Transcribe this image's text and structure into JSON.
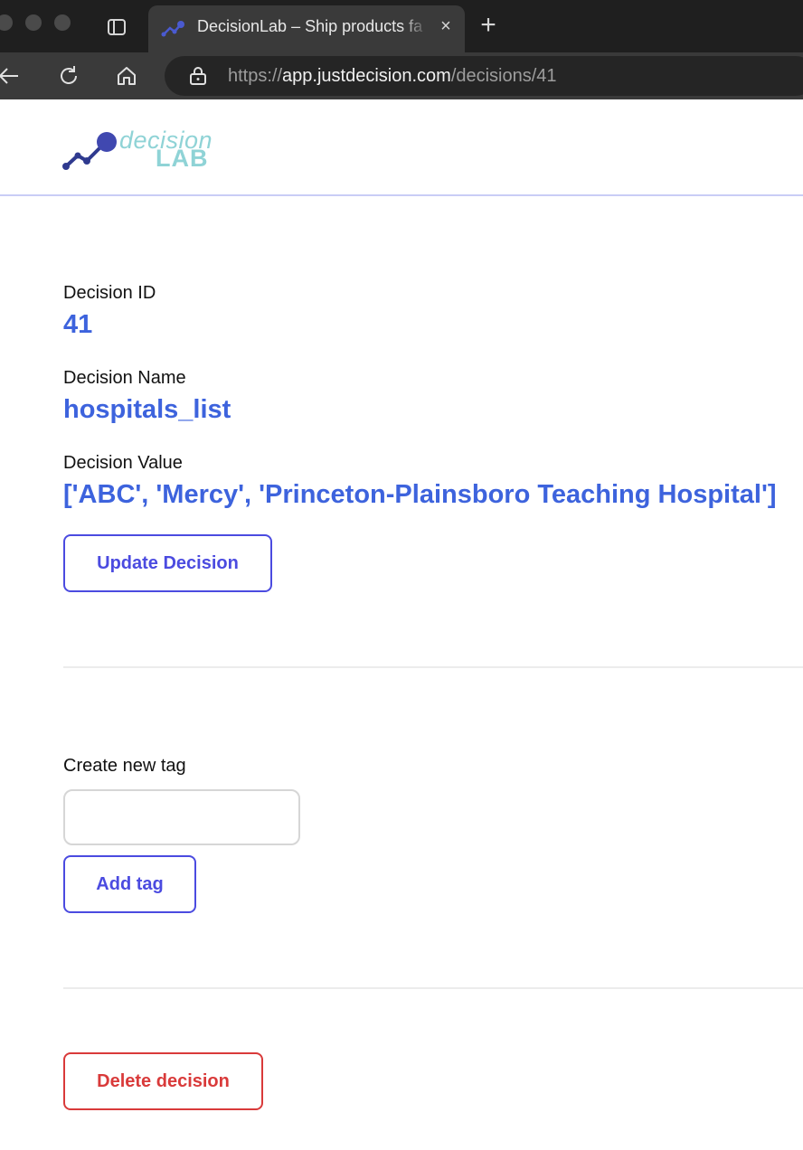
{
  "browser": {
    "tab_title": "DecisionLab – Ship products fa",
    "close_glyph": "×",
    "new_tab_glyph": "+",
    "url_scheme": "https://",
    "url_host": "app.justdecision.com",
    "url_path": "/decisions/41",
    "icons": [
      "tab-overview-icon",
      "back-icon",
      "reload-icon",
      "home-icon",
      "lock-icon",
      "favicon"
    ]
  },
  "logo": {
    "top_text": "decision",
    "bottom_text": "LAB"
  },
  "decision": {
    "id_label": "Decision ID",
    "id_value": "41",
    "name_label": "Decision Name",
    "name_value": "hospitals_list",
    "value_label": "Decision Value",
    "value_value": "['ABC', 'Mercy', 'Princeton-Plainsboro Teaching Hospital']",
    "update_button": "Update Decision"
  },
  "tags": {
    "create_label": "Create new tag",
    "input_value": "",
    "add_button": "Add tag"
  },
  "danger": {
    "delete_button": "Delete decision"
  },
  "colors": {
    "accent_blue": "#3d63dd",
    "button_indigo": "#4b4be0",
    "danger_red": "#d93a3a",
    "logo_teal": "#8fd3d6",
    "logo_navy": "#2f3a8f"
  }
}
